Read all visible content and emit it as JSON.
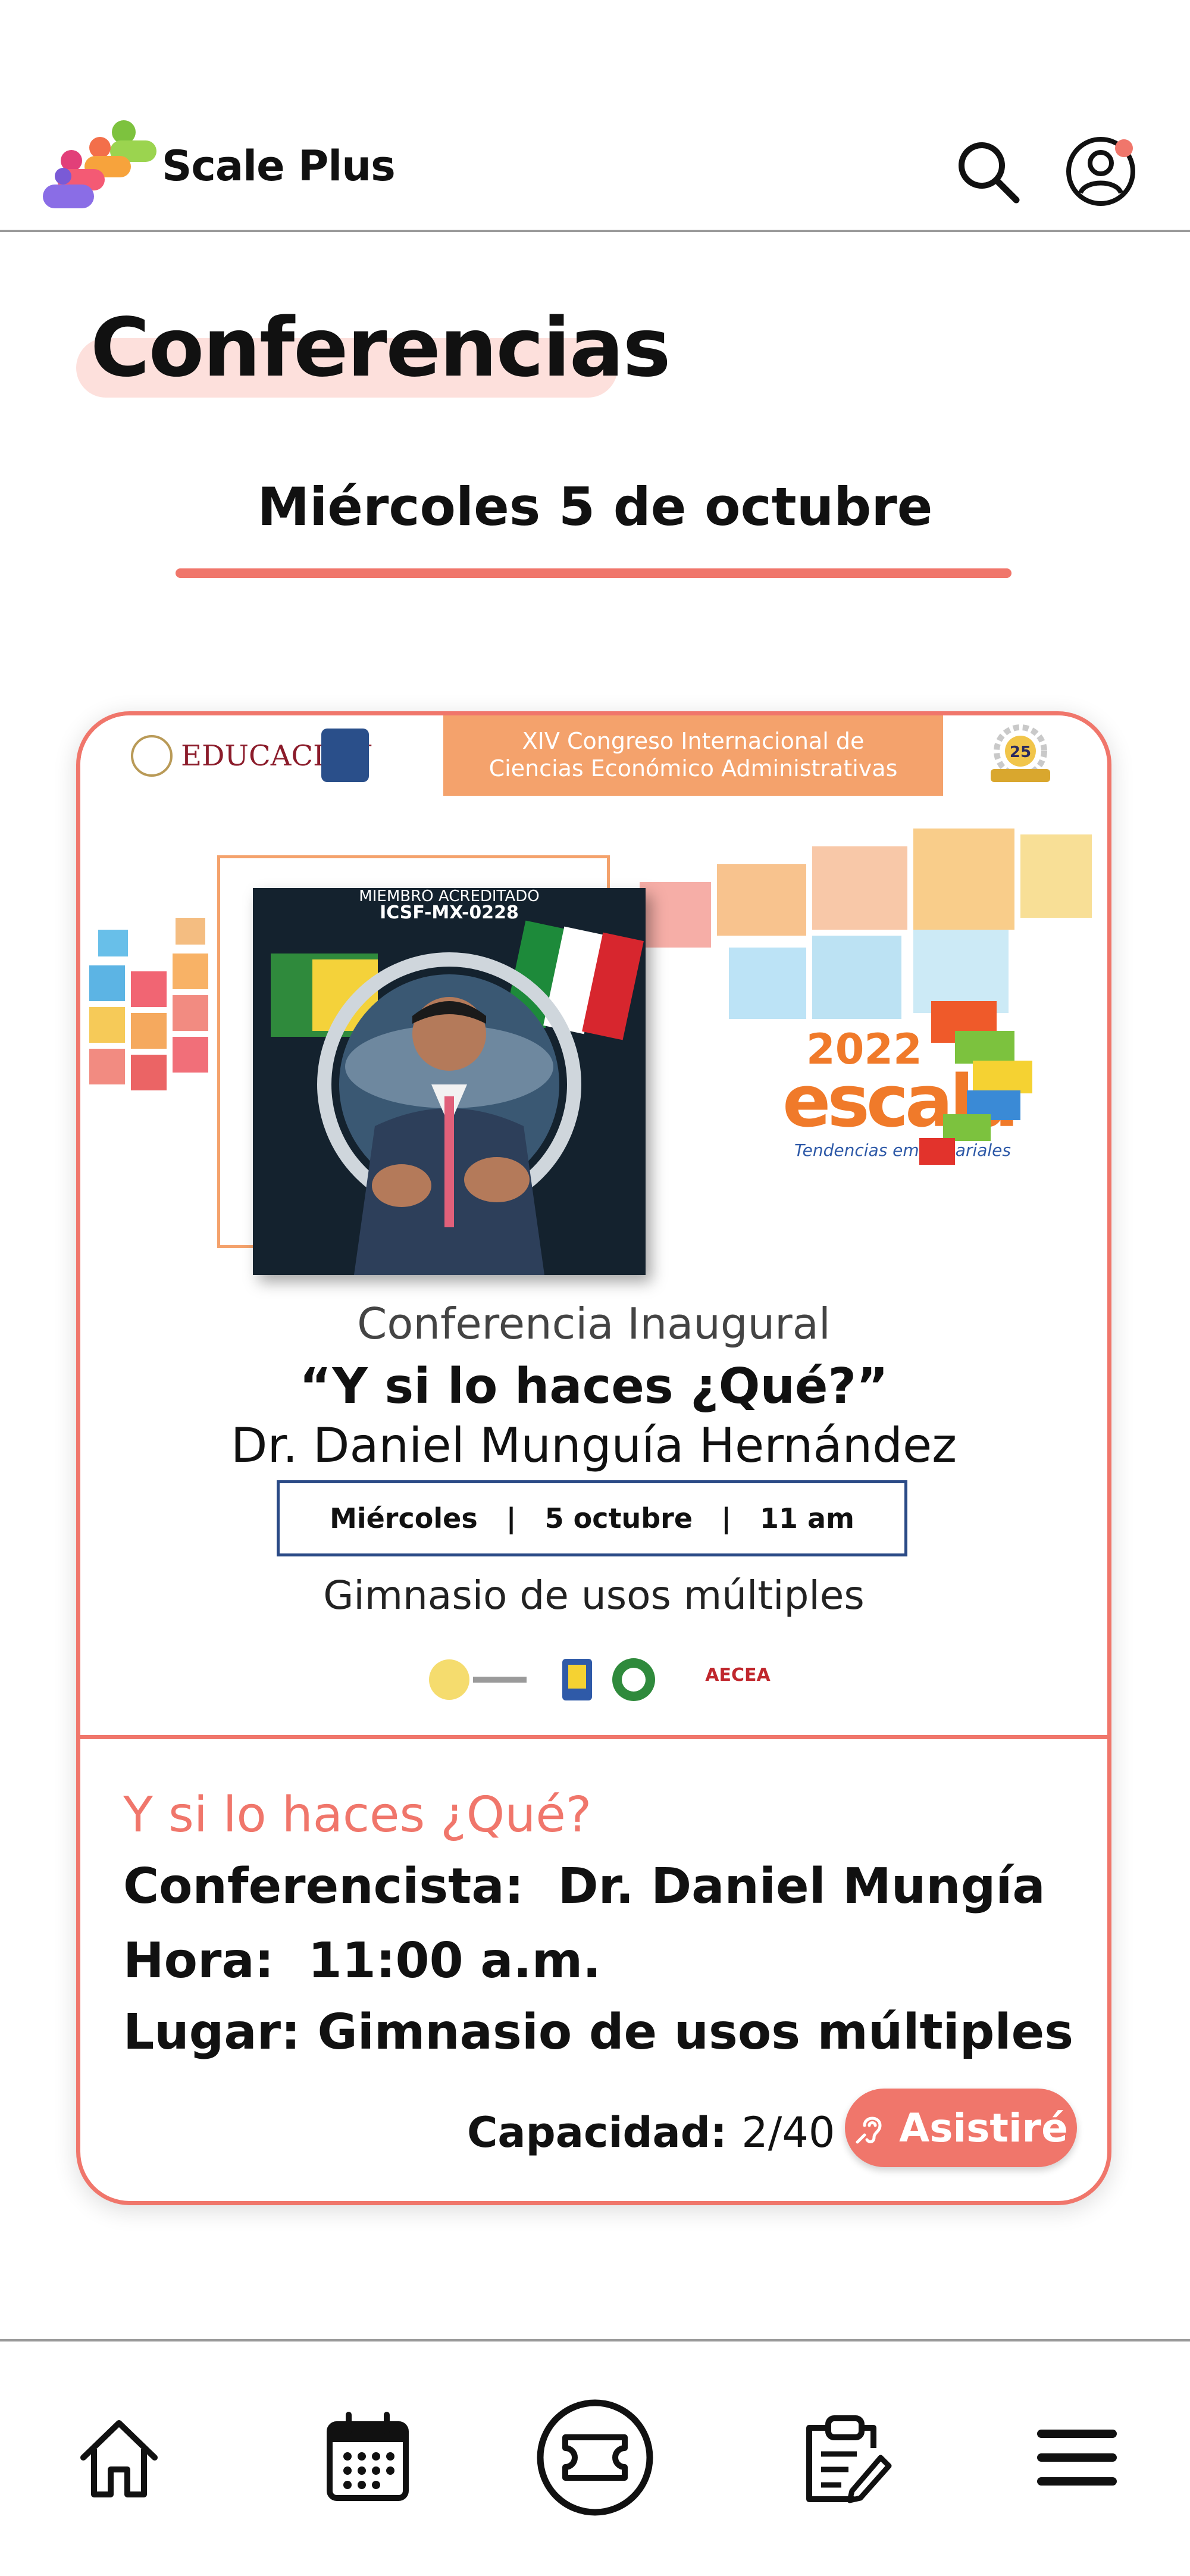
{
  "app": {
    "brand": "Scale Plus",
    "logo_icon": "people-logo-icon",
    "header_icons": [
      "search-icon",
      "user-profile-icon"
    ],
    "accent_color": "#f0766b"
  },
  "page": {
    "title": "Conferencias",
    "date": "Miércoles 5 de octubre"
  },
  "poster": {
    "edu_logo": "EDUCACIÓN",
    "congress_line1": "XIV Congreso Internacional de",
    "congress_line2": "Ciencias Económico Administrativas",
    "badge_number": "25",
    "photo_caption_line1": "MIEMBRO ACREDITADO",
    "photo_caption_line2": "ICSF-MX-0228",
    "escala_year": "2022",
    "escala_name": "escala",
    "escala_tagline": "Tendencias empresariales",
    "event_type": "Conferencia Inaugural",
    "event_title": "“Y si lo haces ¿Qué?”",
    "speaker": "Dr. Daniel Munguía Hernández",
    "schedule": "Miércoles   |   5 octubre   |   11 am",
    "venue": "Gimnasio de usos múltiples",
    "sponsor_logo_text": "AECEA"
  },
  "details": {
    "title": "Y si lo haces ¿Qué?",
    "speaker_label": "Conferencista:",
    "speaker_value": "Dr. Daniel Mungía",
    "time_label": "Hora:",
    "time_value": "11:00 a.m.",
    "place_label": "Lugar:",
    "place_value": "Gimnasio de usos múltiples",
    "capacity_label": "Capacidad:",
    "capacity_value": "2/40",
    "attend_button": "Asistiré"
  },
  "nav": {
    "items": [
      "home-icon",
      "calendar-icon",
      "ticket-icon",
      "clipboard-edit-icon",
      "menu-icon"
    ],
    "active": "ticket-icon"
  }
}
